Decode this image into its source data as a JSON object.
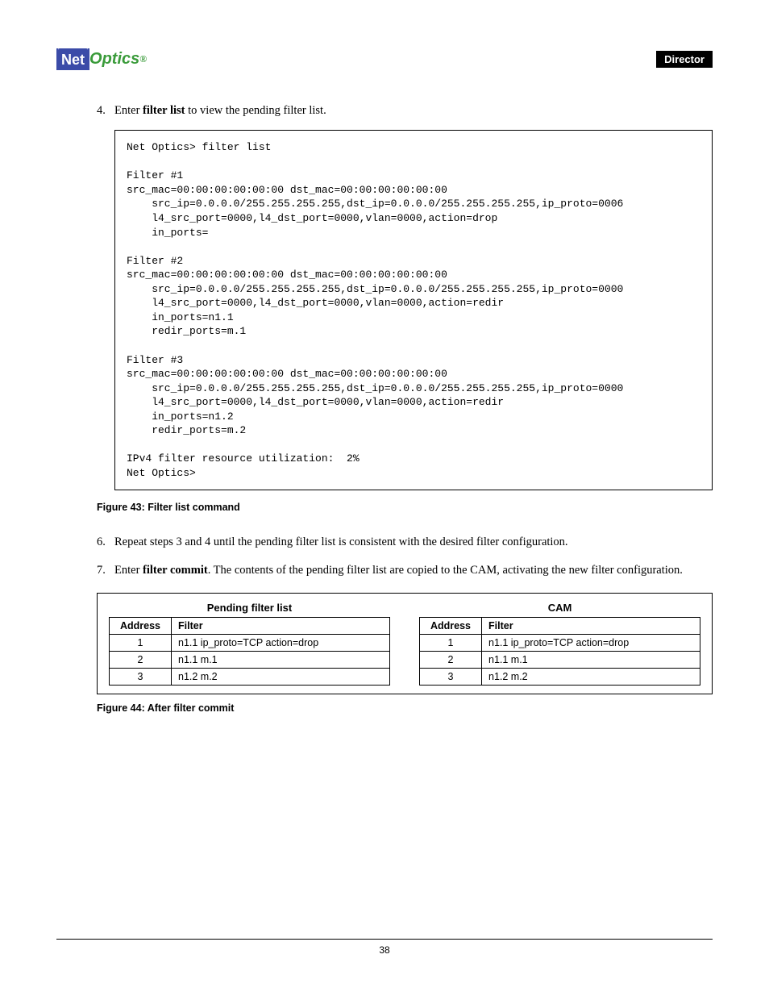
{
  "header": {
    "logo_box": "Net",
    "logo_text": "Optics",
    "logo_reg": "®",
    "tag": "Director"
  },
  "steps": {
    "s4_num": "4.",
    "s4_pre": "Enter ",
    "s4_bold": "filter list",
    "s4_post": " to view the pending filter list.",
    "s6_num": "6.",
    "s6_text": "Repeat steps 3 and 4 until the pending filter list is consistent with the desired filter configuration.",
    "s7_num": "7.",
    "s7_pre": "Enter ",
    "s7_bold": "filter commit",
    "s7_post": ". The contents of the pending filter list are copied to the CAM, activating the new filter configuration."
  },
  "codebox": "Net Optics> filter list\n\nFilter #1\nsrc_mac=00:00:00:00:00:00 dst_mac=00:00:00:00:00:00\n    src_ip=0.0.0.0/255.255.255.255,dst_ip=0.0.0.0/255.255.255.255,ip_proto=0006\n    l4_src_port=0000,l4_dst_port=0000,vlan=0000,action=drop\n    in_ports=\n\nFilter #2\nsrc_mac=00:00:00:00:00:00 dst_mac=00:00:00:00:00:00\n    src_ip=0.0.0.0/255.255.255.255,dst_ip=0.0.0.0/255.255.255.255,ip_proto=0000\n    l4_src_port=0000,l4_dst_port=0000,vlan=0000,action=redir\n    in_ports=n1.1\n    redir_ports=m.1\n\nFilter #3\nsrc_mac=00:00:00:00:00:00 dst_mac=00:00:00:00:00:00\n    src_ip=0.0.0.0/255.255.255.255,dst_ip=0.0.0.0/255.255.255.255,ip_proto=0000\n    l4_src_port=0000,l4_dst_port=0000,vlan=0000,action=redir\n    in_ports=n1.2\n    redir_ports=m.2\n\nIPv4 filter resource utilization:  2%\nNet Optics>",
  "fig43": "Figure 43: Filter list command",
  "fig44": "Figure 44: After filter commit",
  "tables": {
    "left_title": "Pending filter list",
    "right_title": "CAM",
    "h_addr": "Address",
    "h_filter": "Filter",
    "rows": [
      {
        "addr": "1",
        "filter": "n1.1 ip_proto=TCP action=drop"
      },
      {
        "addr": "2",
        "filter": "n1.1 m.1"
      },
      {
        "addr": "3",
        "filter": "n1.2 m.2"
      }
    ]
  },
  "page_number": "38"
}
